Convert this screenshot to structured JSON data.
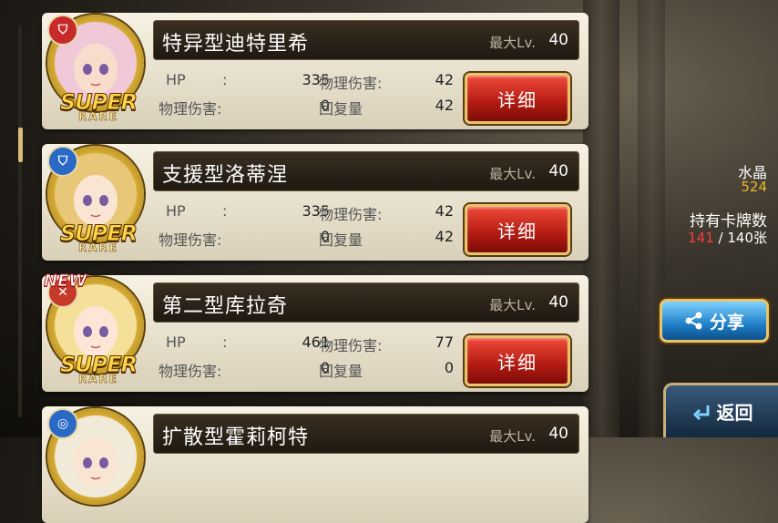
{
  "cards": [
    {
      "type_icon": "shield-icon",
      "type_color": "#c62a2a",
      "is_new": false,
      "name": "特异型迪特里希",
      "lv_label": "最大Lv.",
      "lv": "40",
      "hp_label": "HP",
      "colon": ":",
      "hp": "335",
      "atk_label": "物理伤害:",
      "atk": "42",
      "phys_label": "物理伤害:",
      "phys": "0",
      "heal_label": "回复量",
      "heal": "42",
      "detail_label": "详细",
      "rarity_top": "SUPER",
      "rarity_bottom": "RARE",
      "hair": "#f0c8d8",
      "skin": "#f8dccc"
    },
    {
      "type_icon": "shield-icon",
      "type_color": "#2a6ac6",
      "is_new": false,
      "name": "支援型洛蒂涅",
      "lv_label": "最大Lv.",
      "lv": "40",
      "hp_label": "HP",
      "colon": ":",
      "hp": "335",
      "atk_label": "物理伤害:",
      "atk": "42",
      "phys_label": "物理伤害:",
      "phys": "0",
      "heal_label": "回复量",
      "heal": "42",
      "detail_label": "详细",
      "rarity_top": "SUPER",
      "rarity_bottom": "RARE",
      "hair": "#e8c878",
      "skin": "#fae4d2"
    },
    {
      "type_icon": "sword-icon",
      "type_color": "#c63a2a",
      "is_new": true,
      "new_label": "NEW",
      "name": "第二型库拉奇",
      "lv_label": "最大Lv.",
      "lv": "40",
      "hp_label": "HP",
      "colon": ":",
      "hp": "461",
      "atk_label": "物理伤害:",
      "atk": "77",
      "phys_label": "物理伤害:",
      "phys": "0",
      "heal_label": "回复量",
      "heal": "0",
      "detail_label": "详细",
      "rarity_top": "SUPER",
      "rarity_bottom": "RARE",
      "hair": "#f5e09a",
      "skin": "#fde6d6"
    },
    {
      "type_icon": "swirl-icon",
      "type_color": "#2a6ac6",
      "is_new": false,
      "name": "扩散型霍莉柯特",
      "lv_label": "最大Lv.",
      "lv": "40",
      "hair": "#f2ead8",
      "skin": "#fae4d2"
    }
  ],
  "side": {
    "crystal_label": "水晶",
    "crystal_value": "524",
    "cards_label": "持有卡牌数",
    "cards_owned": "141",
    "cards_sep": " / ",
    "cards_max": "140张"
  },
  "share_label": "分享",
  "back_label": "返回"
}
